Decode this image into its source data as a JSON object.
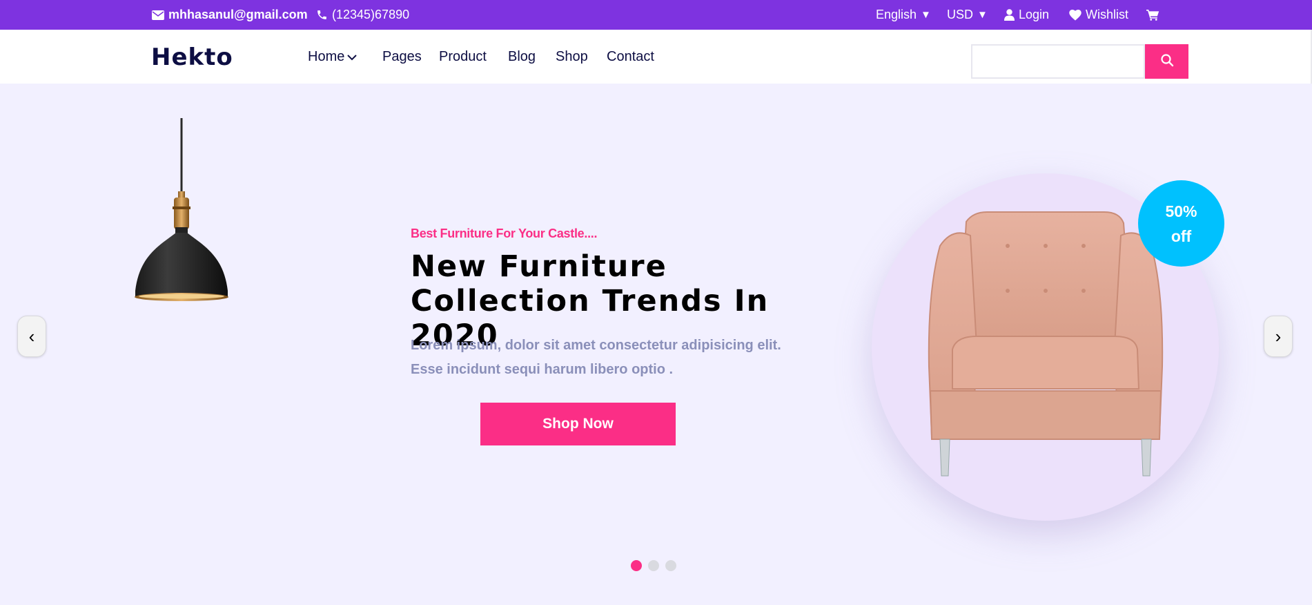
{
  "topbar": {
    "email": "mhhasanul@gmail.com",
    "phone": "(12345)67890",
    "language": "English",
    "currency": "USD",
    "login": "Login",
    "wishlist": "Wishlist",
    "icons": [
      "mail-icon",
      "phone-icon",
      "user-icon",
      "heart-icon",
      "cart-icon"
    ]
  },
  "nav": {
    "logo": "Hekto",
    "links": {
      "home": "Home",
      "pages": "Pages",
      "product": "Product",
      "blog": "Blog",
      "shop": "Shop",
      "contact": "Contact"
    },
    "search_placeholder": ""
  },
  "hero": {
    "tagline": "Best Furniture For Your Castle....",
    "headline": "New Furniture Collection Trends In 2020",
    "description": "Lorem ipsum, dolor sit amet consectetur adipisicing elit. Esse incidunt sequi harum libero optio .",
    "cta": "Shop Now",
    "badge_line1": "50%",
    "badge_line2": "off",
    "prev_arrow": "‹",
    "next_arrow": "›",
    "slides_count": 3,
    "active_slide": 1
  },
  "colors": {
    "topbar": "#7E33E0",
    "accent": "#FB2E86",
    "badge": "#00C1FE",
    "hero_bg": "#F2F0FF",
    "navy": "#0D0E43",
    "muted_text": "#8A8FB9"
  }
}
